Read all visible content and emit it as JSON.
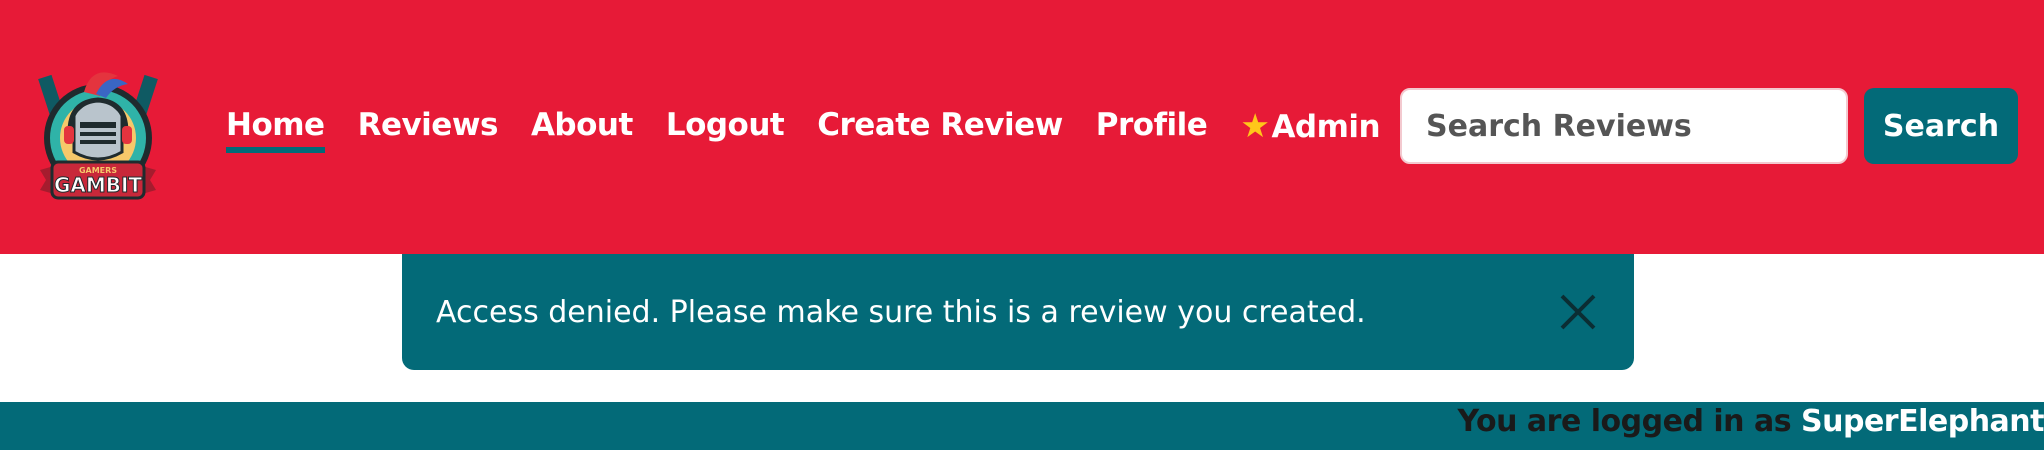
{
  "header": {
    "logo": {
      "top_text": "GAMERS",
      "main_text": "GAMBIT"
    },
    "nav": [
      {
        "label": "Home",
        "active": true
      },
      {
        "label": "Reviews"
      },
      {
        "label": "About"
      },
      {
        "label": "Logout"
      },
      {
        "label": "Create Review"
      },
      {
        "label": "Profile"
      },
      {
        "label": "Admin",
        "icon": "star-icon"
      }
    ],
    "search": {
      "placeholder": "Search Reviews",
      "button_label": "Search"
    }
  },
  "alert": {
    "message": "Access denied. Please make sure this is a review you created.",
    "close_icon": "close-icon"
  },
  "footer": {
    "logged_in_prefix": "You are logged in as",
    "username": "SuperElephant"
  },
  "colors": {
    "brand_red": "#e71a37",
    "teal": "#036a78",
    "star": "#ffc61a"
  }
}
